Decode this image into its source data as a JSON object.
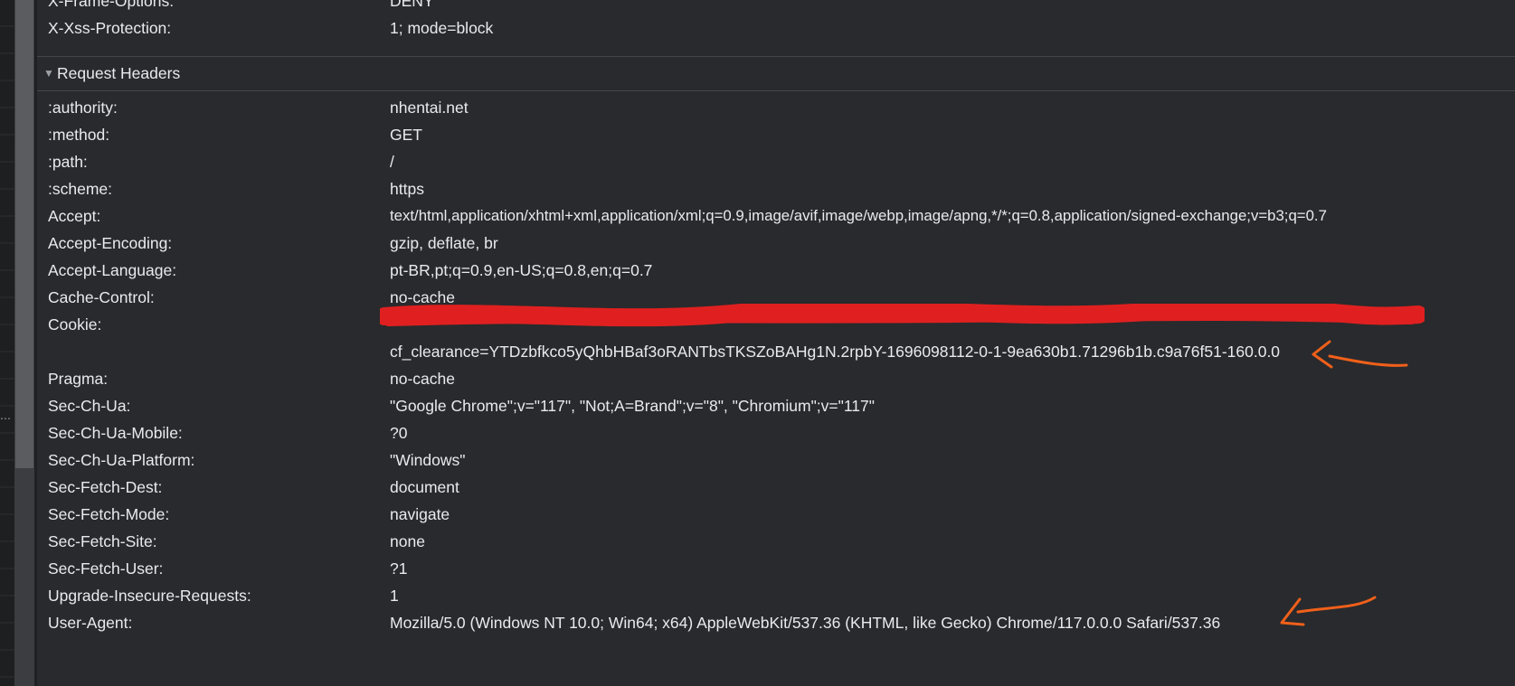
{
  "response_headers_tail": [
    {
      "name": "X-Frame-Options:",
      "value": "DENY"
    },
    {
      "name": "X-Xss-Protection:",
      "value": "1; mode=block"
    }
  ],
  "request_section": {
    "title": "Request Headers"
  },
  "request_headers": [
    {
      "name": ":authority:",
      "value": "nhentai.net"
    },
    {
      "name": ":method:",
      "value": "GET"
    },
    {
      "name": ":path:",
      "value": "/"
    },
    {
      "name": ":scheme:",
      "value": "https"
    },
    {
      "name": "Accept:",
      "value": "text/html,application/xhtml+xml,application/xml;q=0.9,image/avif,image/webp,image/apng,*/*;q=0.8,application/signed-exchange;v=b3;q=0.7"
    },
    {
      "name": "Accept-Encoding:",
      "value": "gzip, deflate, br"
    },
    {
      "name": "Accept-Language:",
      "value": "pt-BR,pt;q=0.9,en-US;q=0.8,en;q=0.7"
    },
    {
      "name": "Cache-Control:",
      "value": "no-cache"
    },
    {
      "name": "Cookie:",
      "value": "",
      "value_line2": "cf_clearance=YTDzbfkco5yQhbHBaf3oRANTbsTKSZoBAHg1N.2rpbY-1696098112-0-1-9ea630b1.71296b1b.c9a76f51-160.0.0"
    },
    {
      "name": "Pragma:",
      "value": "no-cache"
    },
    {
      "name": "Sec-Ch-Ua:",
      "value": "\"Google Chrome\";v=\"117\", \"Not;A=Brand\";v=\"8\", \"Chromium\";v=\"117\""
    },
    {
      "name": "Sec-Ch-Ua-Mobile:",
      "value": "?0"
    },
    {
      "name": "Sec-Ch-Ua-Platform:",
      "value": "\"Windows\""
    },
    {
      "name": "Sec-Fetch-Dest:",
      "value": "document"
    },
    {
      "name": "Sec-Fetch-Mode:",
      "value": "navigate"
    },
    {
      "name": "Sec-Fetch-Site:",
      "value": "none"
    },
    {
      "name": "Sec-Fetch-User:",
      "value": "?1"
    },
    {
      "name": "Upgrade-Insecure-Requests:",
      "value": "1"
    },
    {
      "name": "User-Agent:",
      "value": "Mozilla/5.0 (Windows NT 10.0; Win64; x64) AppleWebKit/537.36 (KHTML, like Gecko) Chrome/117.0.0.0 Safari/537.36"
    }
  ],
  "colors": {
    "background": "#292a2d",
    "text": "#e8eaed",
    "redaction": "#e02020",
    "annotation_arrow": "#f0601a"
  },
  "icons": {
    "section_toggle": "triangle-down-icon",
    "annotation": "arrow-left-icon"
  }
}
